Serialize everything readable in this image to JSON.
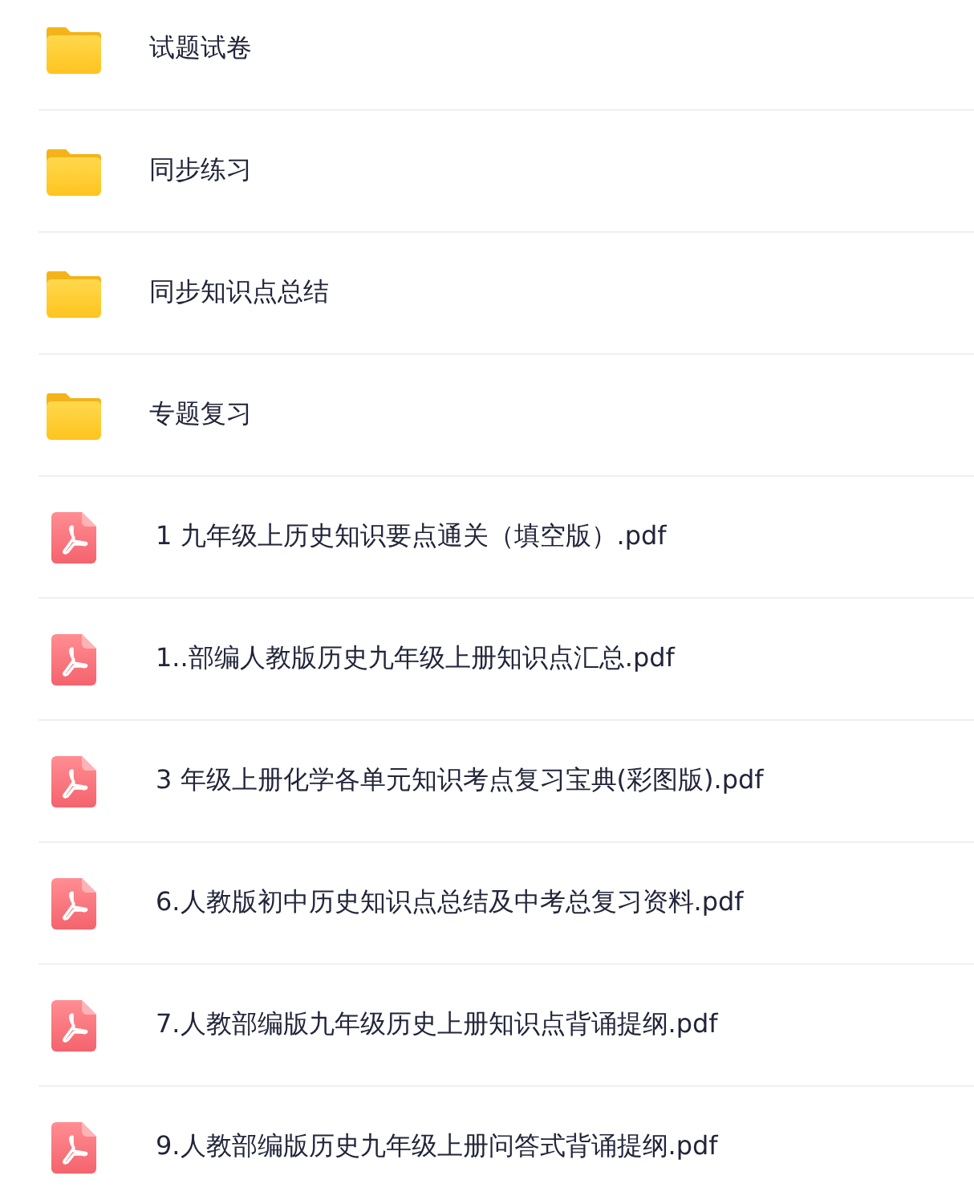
{
  "files": [
    {
      "kind": "folder",
      "name": "试题试卷"
    },
    {
      "kind": "folder",
      "name": "同步练习"
    },
    {
      "kind": "folder",
      "name": "同步知识点总结"
    },
    {
      "kind": "folder",
      "name": "专题复习"
    },
    {
      "kind": "pdf",
      "name": "1 九年级上历史知识要点通关（填空版）.pdf"
    },
    {
      "kind": "pdf",
      "name": "1..部编人教版历史九年级上册知识点汇总.pdf"
    },
    {
      "kind": "pdf",
      "name": "3 年级上册化学各单元知识考点复习宝典(彩图版).pdf"
    },
    {
      "kind": "pdf",
      "name": "6.人教版初中历史知识点总结及中考总复习资料.pdf"
    },
    {
      "kind": "pdf",
      "name": "7.人教部编版九年级历史上册知识点背诵提纲.pdf"
    },
    {
      "kind": "pdf",
      "name": "9.人教部编版历史九年级上册问答式背诵提纲.pdf"
    }
  ]
}
